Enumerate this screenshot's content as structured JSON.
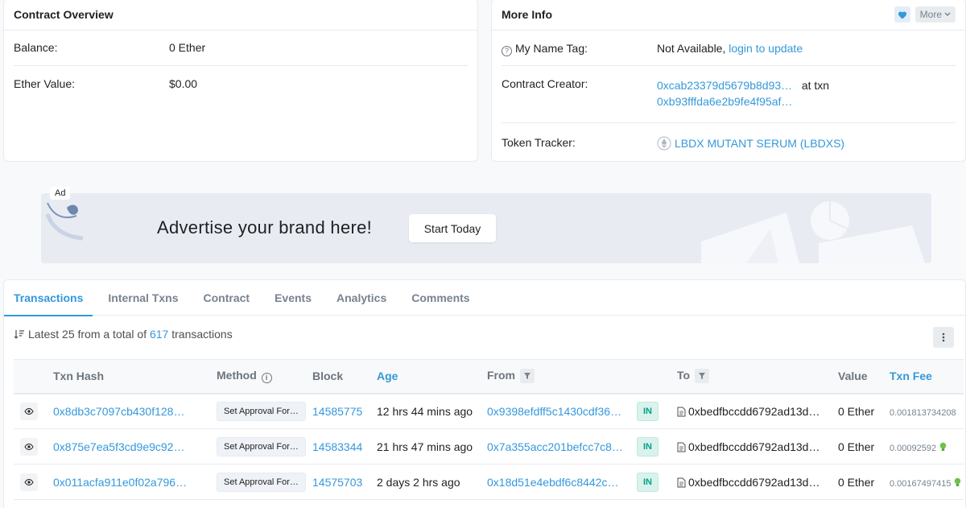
{
  "overview": {
    "title": "Contract Overview",
    "balance_label": "Balance:",
    "balance_value": "0 Ether",
    "ether_value_label": "Ether Value:",
    "ether_value": "$0.00"
  },
  "more_info": {
    "title": "More Info",
    "more_label": "More",
    "name_tag_label": "My Name Tag:",
    "name_tag_value": "Not Available,",
    "name_tag_link": "login to update",
    "creator_label": "Contract Creator:",
    "creator_address": "0xcab23379d5679b8d93…",
    "creator_at": "at txn",
    "creator_txn": "0xb93fffda6e2b9fe4f95af…",
    "token_tracker_label": "Token Tracker:",
    "token_tracker_value": "LBDX MUTANT SERUM (LBDXS)"
  },
  "ad": {
    "badge": "Ad",
    "text": "Advertise your brand here!",
    "button": "Start Today"
  },
  "tabs": [
    "Transactions",
    "Internal Txns",
    "Contract",
    "Events",
    "Analytics",
    "Comments"
  ],
  "summary": {
    "prefix": "Latest 25 from a total of",
    "count": "617",
    "suffix": "transactions"
  },
  "table": {
    "headers": {
      "txn_hash": "Txn Hash",
      "method": "Method",
      "block": "Block",
      "age": "Age",
      "from": "From",
      "to": "To",
      "value": "Value",
      "txn_fee": "Txn Fee"
    },
    "rows": [
      {
        "hash": "0x8db3c7097cb430f128…",
        "method": "Set Approval For…",
        "block": "14585775",
        "age": "12 hrs 44 mins ago",
        "from": "0x9398efdff5c1430cdf36…",
        "direction": "IN",
        "to": "0xbedfbccdd6792ad13d…",
        "value": "0 Ether",
        "fee": "0.001813734208"
      },
      {
        "hash": "0x875e7ea5f3cd9e9c92…",
        "method": "Set Approval For…",
        "block": "14583344",
        "age": "21 hrs 47 mins ago",
        "from": "0x7a355acc201befcc7c8…",
        "direction": "IN",
        "to": "0xbedfbccdd6792ad13d…",
        "value": "0 Ether",
        "fee": "0.00092592"
      },
      {
        "hash": "0x011acfa911e0f02a796…",
        "method": "Set Approval For…",
        "block": "14575703",
        "age": "2 days 2 hrs ago",
        "from": "0x18d51e4ebdf6c8442c…",
        "direction": "IN",
        "to": "0xbedfbccdd6792ad13d…",
        "value": "0 Ether",
        "fee": "0.00167497415"
      }
    ]
  },
  "colors": {
    "link": "#3498db",
    "in_badge_bg": "#d9f3ec",
    "in_badge_text": "#00a186"
  }
}
